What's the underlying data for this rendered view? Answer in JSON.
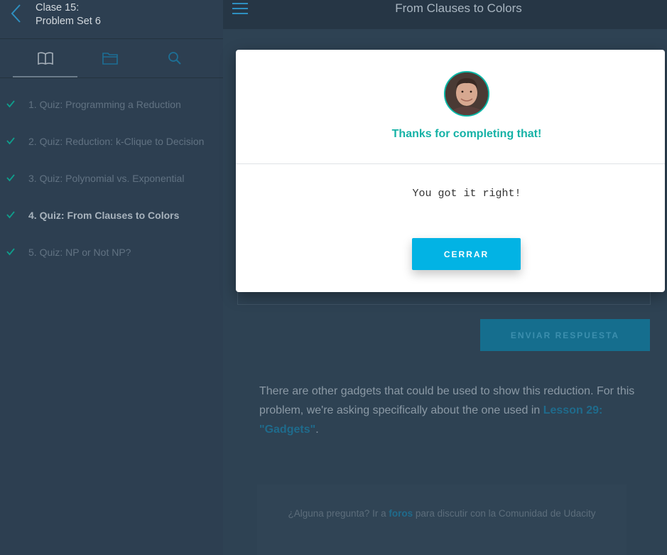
{
  "sidebar": {
    "lesson_title_line1": "Clase 15:",
    "lesson_title_line2": "Problem Set 6",
    "tabs": [
      "book-icon",
      "folder-icon",
      "search-icon"
    ],
    "items": [
      {
        "label": "1. Quiz: Programming a Reduction"
      },
      {
        "label": "2. Quiz: Reduction: k-Clique to Decision"
      },
      {
        "label": "3. Quiz: Polynomial vs. Exponential"
      },
      {
        "label": "4. Quiz: From Clauses to Colors"
      },
      {
        "label": "5. Quiz: NP or Not NP?"
      }
    ]
  },
  "topbar": {
    "title": "From Clauses to Colors"
  },
  "content": {
    "submit_label": "ENVIAR RESPUESTA",
    "paragraph_text": "There are other gadgets that could be used to show this reduction. For this problem, we're asking specifically about the one used in ",
    "paragraph_link": "Lesson 29: \"Gadgets\"",
    "paragraph_end": ".",
    "footer_pre": "¿Alguna pregunta? Ir a ",
    "footer_link": "foros",
    "footer_post": " para discutir con la Comunidad de Udacity"
  },
  "modal": {
    "title": "Thanks for completing that!",
    "message": "You got it right!",
    "close_label": "CERRAR"
  },
  "colors": {
    "accent_teal": "#15b2a6",
    "button_blue": "#02b3e4",
    "check_green": "#0f9e8c"
  }
}
